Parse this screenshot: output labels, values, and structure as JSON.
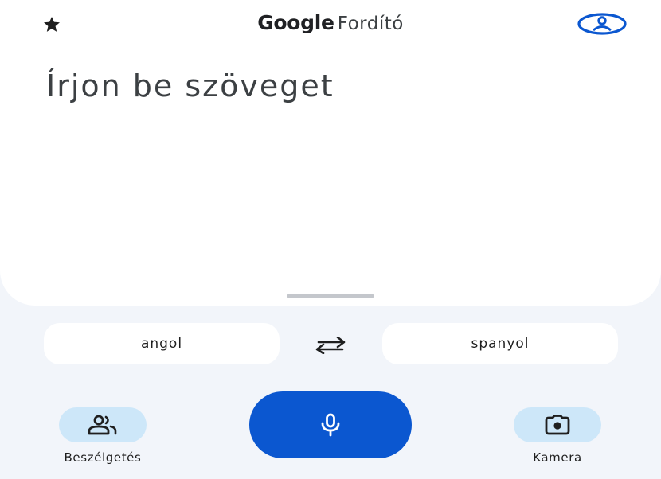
{
  "header": {
    "brand": "Google",
    "product": "Fordító",
    "icons": {
      "left": "star-icon",
      "right": "account-icon"
    }
  },
  "input": {
    "placeholder": "Írjon be szöveget"
  },
  "languages": {
    "source": "angol",
    "target": "spanyol",
    "swap_icon": "swap-arrows-icon"
  },
  "actions": {
    "conversation_label": "Beszélgetés",
    "conversation_icon": "people-icon",
    "mic_icon": "microphone-icon",
    "camera_label": "Kamera",
    "camera_icon": "camera-icon"
  },
  "colors": {
    "accent": "#0b57d0",
    "chip": "#cde7f9",
    "background": "#f2f5fa",
    "surface": "#ffffff"
  }
}
